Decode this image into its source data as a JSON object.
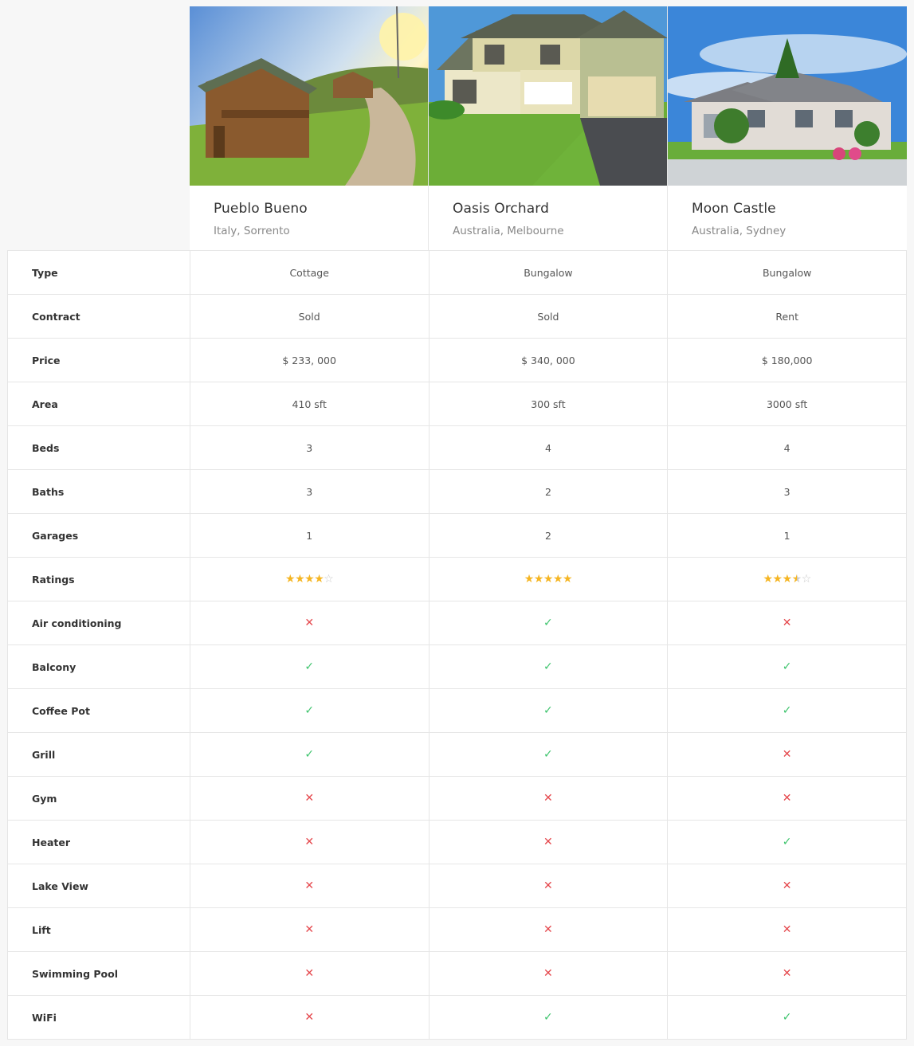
{
  "properties": [
    {
      "title": "Pueblo Bueno",
      "location": "Italy, Sorrento",
      "photo": "mountain-cottage-photo"
    },
    {
      "title": "Oasis Orchard",
      "location": "Australia, Melbourne",
      "photo": "suburban-bungalow-photo"
    },
    {
      "title": "Moon Castle",
      "location": "Australia, Sydney",
      "photo": "large-house-photo"
    }
  ],
  "text_rows": [
    {
      "label": "Type",
      "values": [
        "Cottage",
        "Bungalow",
        "Bungalow"
      ]
    },
    {
      "label": "Contract",
      "values": [
        "Sold",
        "Sold",
        "Rent"
      ]
    },
    {
      "label": "Price",
      "values": [
        "$ 233, 000",
        "$ 340, 000",
        "$ 180,000"
      ]
    },
    {
      "label": "Area",
      "values": [
        "410 sft",
        "300 sft",
        "3000 sft"
      ]
    },
    {
      "label": "Beds",
      "values": [
        "3",
        "4",
        "4"
      ]
    },
    {
      "label": "Baths",
      "values": [
        "3",
        "2",
        "3"
      ]
    },
    {
      "label": "Garages",
      "values": [
        "1",
        "2",
        "1"
      ]
    }
  ],
  "ratings": {
    "label": "Ratings",
    "values": [
      4,
      5,
      3.5
    ],
    "max": 5
  },
  "feature_rows": [
    {
      "label": "Air conditioning",
      "values": [
        false,
        true,
        false
      ]
    },
    {
      "label": "Balcony",
      "values": [
        true,
        true,
        true
      ]
    },
    {
      "label": "Coffee Pot",
      "values": [
        true,
        true,
        true
      ]
    },
    {
      "label": "Grill",
      "values": [
        true,
        true,
        false
      ]
    },
    {
      "label": "Gym",
      "values": [
        false,
        false,
        false
      ]
    },
    {
      "label": "Heater",
      "values": [
        false,
        false,
        true
      ]
    },
    {
      "label": "Lake View",
      "values": [
        false,
        false,
        false
      ]
    },
    {
      "label": "Lift",
      "values": [
        false,
        false,
        false
      ]
    },
    {
      "label": "Swimming Pool",
      "values": [
        false,
        false,
        false
      ]
    },
    {
      "label": "WiFi",
      "values": [
        false,
        true,
        true
      ]
    }
  ],
  "icons": {
    "yes": "check-icon",
    "no": "cross-icon",
    "star": "star-icon"
  },
  "colors": {
    "yes": "#3ec46d",
    "no": "#e5484d",
    "star": "#f5b522"
  }
}
